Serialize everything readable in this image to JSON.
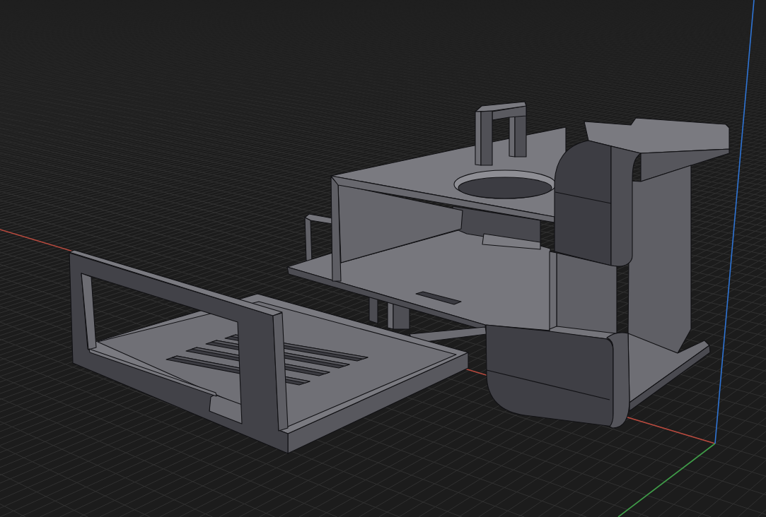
{
  "viewport": {
    "axes": [
      {
        "color": "#b94a3e"
      },
      {
        "color": "#3f9c48"
      },
      {
        "color": "#2f74d4"
      }
    ]
  }
}
